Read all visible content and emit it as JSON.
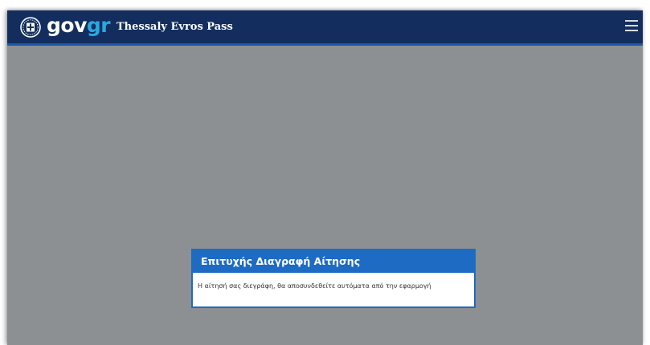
{
  "header": {
    "logo_gov": "gov",
    "logo_gr": "gr",
    "app_title": "Thessaly Evros Pass",
    "background_color": "#132e5e",
    "accent_color": "#2aa9e0",
    "emblem_icon": "greek-state-emblem-icon",
    "menu_icon": "hamburger-menu-icon"
  },
  "overlay": {
    "color": "#8d9093"
  },
  "dialog": {
    "title": "Επιτυχής Διαγραφή Αίτησης",
    "message": "Η αίτησή σας διεγράφη, θα αποσυνδεθείτε αυτόματα από την εφαρμογή",
    "title_background_color": "#1e6bc4"
  }
}
